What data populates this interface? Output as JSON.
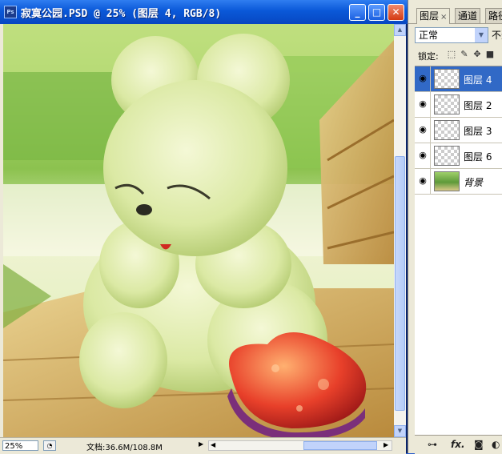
{
  "document_window": {
    "title": "寂寞公园.PSD @ 25% (图层 4, RGB/8)",
    "app_icon_label": "Ps",
    "minimize_symbol": "_",
    "maximize_symbol": "□",
    "close_symbol": "✕",
    "status": {
      "zoom": "25%",
      "doc_info": "文档:36.6M/108.8M"
    }
  },
  "layers_panel": {
    "tabs": [
      {
        "label": "图层",
        "active": true
      },
      {
        "label": "通道",
        "active": false
      },
      {
        "label": "路径",
        "active": false
      }
    ],
    "blend_mode": "正常",
    "opacity_label": "不透",
    "lock_label": "锁定:",
    "layers": [
      {
        "name": "图层 4",
        "visible": true,
        "selected": true
      },
      {
        "name": "图层 2",
        "visible": true,
        "selected": false
      },
      {
        "name": "图层 3",
        "visible": true,
        "selected": false
      },
      {
        "name": "图层 6",
        "visible": true,
        "selected": false
      },
      {
        "name": "背景",
        "visible": true,
        "selected": false
      }
    ],
    "bottom_icons": [
      "link-icon",
      "fx-icon",
      "mask-icon",
      "adjustment-icon"
    ],
    "fx_label": "fx."
  },
  "colors": {
    "titlebar": "#0a58d8",
    "selected_layer": "#3169c6",
    "close_button": "#d43a12"
  }
}
